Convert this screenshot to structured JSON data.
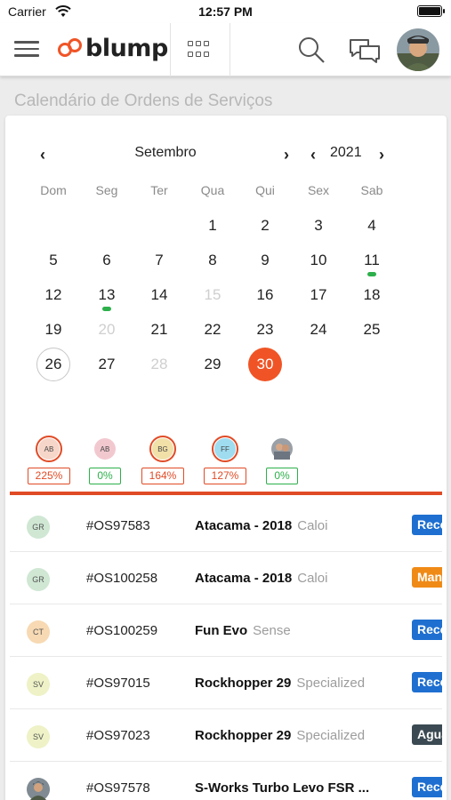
{
  "status_bar": {
    "carrier": "Carrier",
    "time": "12:57 PM"
  },
  "header": {
    "logo_text": "blump",
    "logo_color": "#f05426"
  },
  "page_title": "Calendário de Ordens de Serviços",
  "calendar": {
    "month": "Setembro",
    "year": "2021",
    "weekdays": [
      "Dom",
      "Seg",
      "Ter",
      "Qua",
      "Qui",
      "Sex",
      "Sab"
    ],
    "days": [
      {
        "label": "1",
        "col": 3,
        "row": 0
      },
      {
        "label": "2",
        "col": 4,
        "row": 0
      },
      {
        "label": "3",
        "col": 5,
        "row": 0
      },
      {
        "label": "4",
        "col": 6,
        "row": 0
      },
      {
        "label": "5",
        "col": 0,
        "row": 1
      },
      {
        "label": "6",
        "col": 1,
        "row": 1
      },
      {
        "label": "7",
        "col": 2,
        "row": 1
      },
      {
        "label": "8",
        "col": 3,
        "row": 1
      },
      {
        "label": "9",
        "col": 4,
        "row": 1
      },
      {
        "label": "10",
        "col": 5,
        "row": 1
      },
      {
        "label": "11",
        "col": 6,
        "row": 1,
        "event": true
      },
      {
        "label": "12",
        "col": 0,
        "row": 2
      },
      {
        "label": "13",
        "col": 1,
        "row": 2,
        "event": true
      },
      {
        "label": "14",
        "col": 2,
        "row": 2
      },
      {
        "label": "15",
        "col": 3,
        "row": 2,
        "muted": true
      },
      {
        "label": "16",
        "col": 4,
        "row": 2
      },
      {
        "label": "17",
        "col": 5,
        "row": 2
      },
      {
        "label": "18",
        "col": 6,
        "row": 2
      },
      {
        "label": "19",
        "col": 0,
        "row": 3
      },
      {
        "label": "20",
        "col": 1,
        "row": 3,
        "muted": true
      },
      {
        "label": "21",
        "col": 2,
        "row": 3
      },
      {
        "label": "22",
        "col": 3,
        "row": 3
      },
      {
        "label": "23",
        "col": 4,
        "row": 3
      },
      {
        "label": "24",
        "col": 5,
        "row": 3
      },
      {
        "label": "25",
        "col": 6,
        "row": 3
      },
      {
        "label": "26",
        "col": 0,
        "row": 4,
        "today": true
      },
      {
        "label": "27",
        "col": 1,
        "row": 4
      },
      {
        "label": "28",
        "col": 2,
        "row": 4,
        "muted": true
      },
      {
        "label": "29",
        "col": 3,
        "row": 4
      },
      {
        "label": "30",
        "col": 4,
        "row": 4,
        "selected": true
      }
    ],
    "event_dot_color": "#2db04b",
    "selected_color": "#f05426"
  },
  "technicians": [
    {
      "initials": "AB",
      "percent": "225%",
      "status": "over",
      "bg": "#f6d6c9"
    },
    {
      "initials": "AB",
      "percent": "0%",
      "status": "ok",
      "bg": "#f2c8cf"
    },
    {
      "initials": "BG",
      "percent": "164%",
      "status": "over",
      "bg": "#f1e0a8"
    },
    {
      "initials": "FF",
      "percent": "127%",
      "status": "over",
      "bg": "#9fdcf0"
    },
    {
      "initials": "",
      "percent": "0%",
      "status": "ok",
      "photo": true
    }
  ],
  "technician_colors": {
    "over": "#e04b26",
    "ok": "#2db04b"
  },
  "orders": [
    {
      "initials": "GR",
      "avatar_bg": "#cfe7d3",
      "os": "#OS97583",
      "model": "Atacama - 2018",
      "brand": "Caloi",
      "status": "Rece",
      "status_color": "#1e6fd0"
    },
    {
      "initials": "GR",
      "avatar_bg": "#cfe7d3",
      "os": "#OS100258",
      "model": "Atacama - 2018",
      "brand": "Caloi",
      "status": "Man",
      "status_color": "#f08a16"
    },
    {
      "initials": "CT",
      "avatar_bg": "#f7d9b3",
      "os": "#OS100259",
      "model": "Fun Evo",
      "brand": "Sense",
      "status": "Rece",
      "status_color": "#1e6fd0"
    },
    {
      "initials": "SV",
      "avatar_bg": "#eef2c6",
      "os": "#OS97015",
      "model": "Rockhopper 29",
      "brand": "Specialized",
      "status": "Rece",
      "status_color": "#1e6fd0"
    },
    {
      "initials": "SV",
      "avatar_bg": "#eef2c6",
      "os": "#OS97023",
      "model": "Rockhopper 29",
      "brand": "Specialized",
      "status": "Agua",
      "status_color": "#3b4a52"
    },
    {
      "initials": "",
      "avatar_bg": "",
      "photo": true,
      "os": "#OS97578",
      "model": "S-Works Turbo Levo FSR ...",
      "brand": "",
      "status": "Rece",
      "status_color": "#1e6fd0"
    }
  ]
}
